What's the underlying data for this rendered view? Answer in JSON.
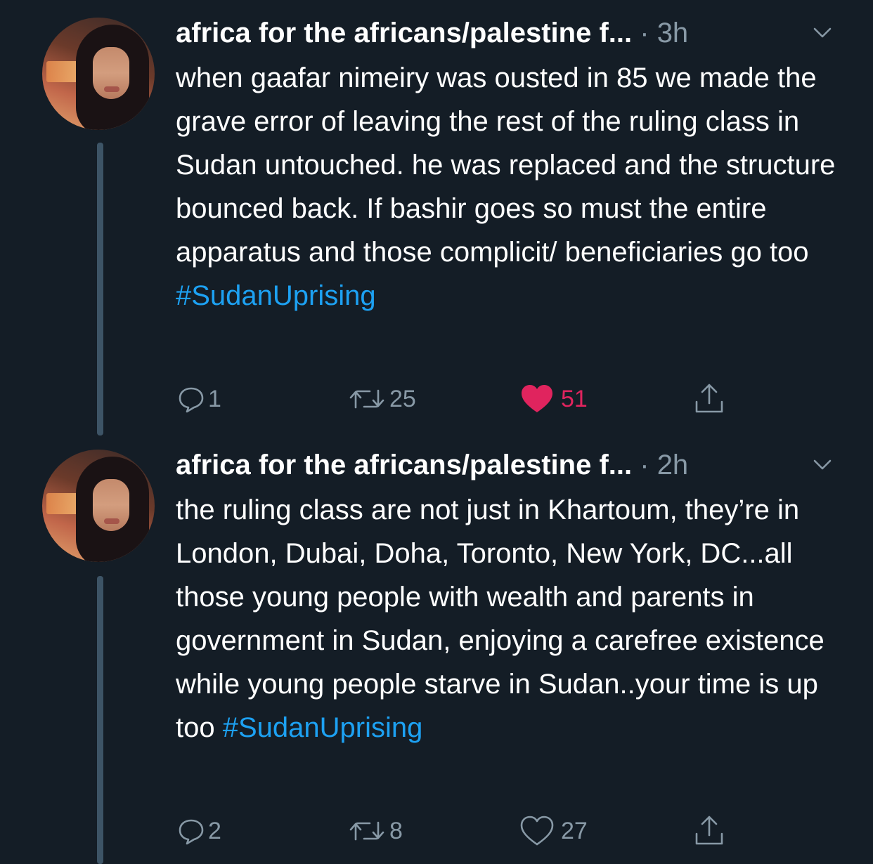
{
  "tweets": [
    {
      "author_name": "africa for the africans/palestine f...",
      "separator": "·",
      "time": "3h",
      "text": "when gaafar nimeiry was ousted in 85 we made the grave error of leaving the rest of the ruling class in Sudan untouched. he was replaced and the structure bounced back. If bashir goes so must the entire apparatus and those complicit/ beneficiaries go too",
      "hashtag": "#SudanUprising",
      "replies": "1",
      "retweets": "25",
      "likes": "51",
      "liked": true
    },
    {
      "author_name": "africa for the africans/palestine f...",
      "separator": "·",
      "time": "2h",
      "text": "the ruling class are not just in Khartoum, they’re in London, Dubai, Doha, Toronto, New York, DC...all those young people with wealth and parents in government in Sudan, enjoying a carefree existence while young people starve in Sudan..your time is up too",
      "hashtag": "#SudanUprising",
      "replies": "2",
      "retweets": "8",
      "likes": "27",
      "liked": false
    }
  ],
  "colors": {
    "background": "#141d26",
    "text": "#ffffff",
    "secondary": "#8899a6",
    "link": "#1da1f2",
    "like": "#e0245e",
    "thread_line": "#3d5466"
  },
  "icons": [
    "reply-icon",
    "retweet-icon",
    "heart-icon",
    "share-icon",
    "chevron-down-icon"
  ]
}
